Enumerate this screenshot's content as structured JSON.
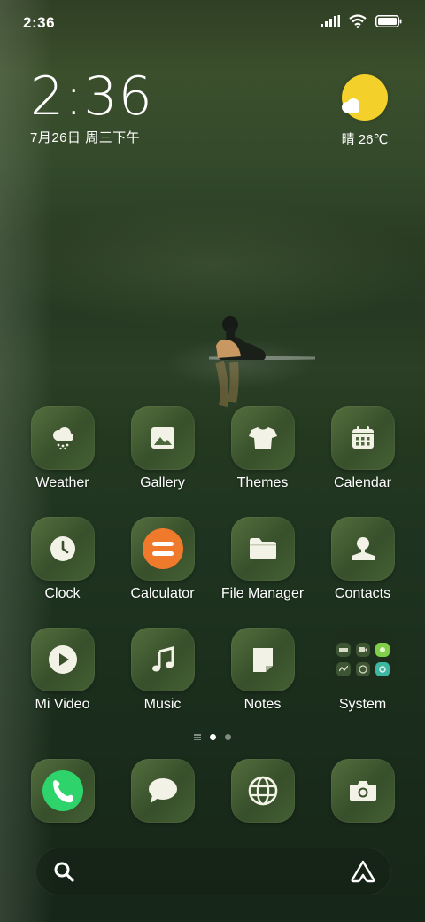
{
  "status_bar": {
    "time": "2:36",
    "icons": [
      "signal-icon",
      "wifi-icon",
      "battery-icon"
    ]
  },
  "clock_widget": {
    "time": "2:36",
    "date": "7月26日 周三下午"
  },
  "weather_widget": {
    "condition_icon": "sun-cloud-icon",
    "text": "晴 26℃",
    "sun_color": "#f4d12a"
  },
  "apps": [
    {
      "label": "Weather",
      "icon": "weather-cloud-icon"
    },
    {
      "label": "Gallery",
      "icon": "gallery-icon"
    },
    {
      "label": "Themes",
      "icon": "tshirt-icon"
    },
    {
      "label": "Calendar",
      "icon": "calendar-icon"
    },
    {
      "label": "Clock",
      "icon": "clock-icon"
    },
    {
      "label": "Calculator",
      "icon": "calculator-icon",
      "accent": "#f07a2c"
    },
    {
      "label": "File Manager",
      "icon": "folder-icon"
    },
    {
      "label": "Contacts",
      "icon": "contact-icon"
    },
    {
      "label": "Mi Video",
      "icon": "play-icon"
    },
    {
      "label": "Music",
      "icon": "music-note-icon"
    },
    {
      "label": "Notes",
      "icon": "notes-icon"
    },
    {
      "label": "System",
      "icon": "system-folder-icon"
    }
  ],
  "page_indicator": {
    "pages": 2,
    "current": 1
  },
  "dock": [
    {
      "icon": "phone-icon",
      "accent": "#2fd36b"
    },
    {
      "icon": "message-icon"
    },
    {
      "icon": "browser-globe-icon"
    },
    {
      "icon": "camera-icon"
    }
  ],
  "search_bar": {
    "left_icon": "search-icon",
    "right_icon": "assistant-icon"
  }
}
